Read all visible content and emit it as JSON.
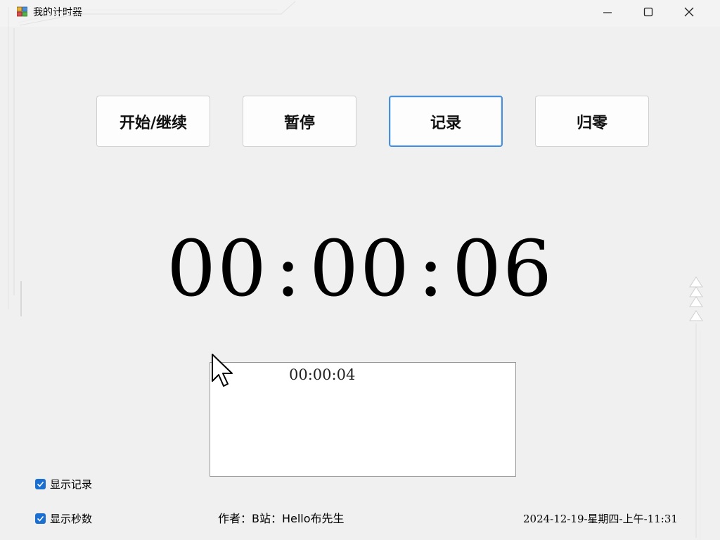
{
  "window": {
    "title": "我的计时器",
    "controls": {
      "minimize": "minimize",
      "maximize": "maximize",
      "close": "close"
    }
  },
  "toolbar": {
    "start_label": "开始/继续",
    "pause_label": "暂停",
    "record_label": "记录",
    "reset_label": "归零"
  },
  "timer": {
    "hours": "00",
    "minutes": "00",
    "seconds": "06",
    "separator": ":"
  },
  "records": {
    "items": [
      "00:00:04"
    ]
  },
  "options": {
    "show_records": {
      "label": "显示记录",
      "checked": true
    },
    "show_seconds": {
      "label": "显示秒数",
      "checked": true
    }
  },
  "footer": {
    "author": "作者：B站：Hello布先生",
    "datetime": "2024-12-19-星期四-上午-11:31"
  },
  "colors": {
    "accent": "#1a6fd1",
    "focus_border": "#4a90d9",
    "background": "#f0f0f0"
  }
}
